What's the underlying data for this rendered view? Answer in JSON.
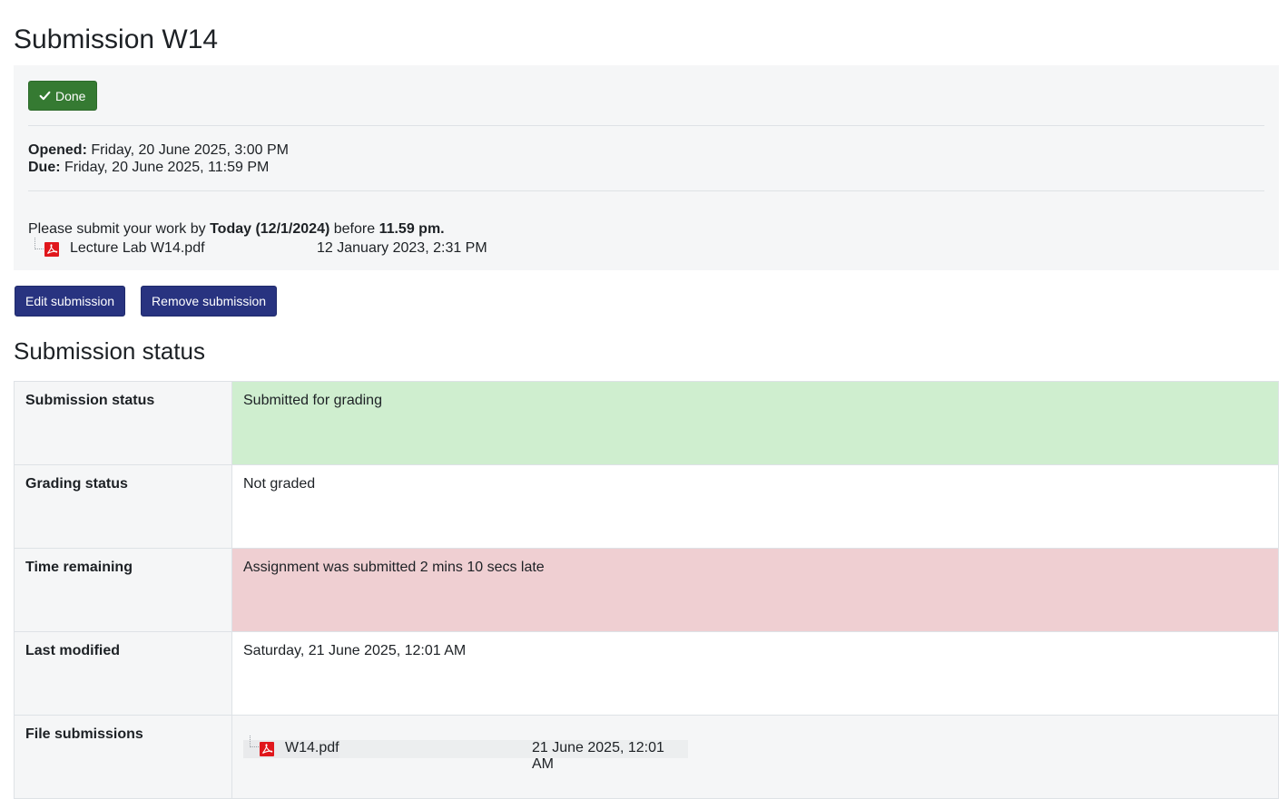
{
  "page_title": "Submission W14",
  "completion": {
    "done_label": "Done"
  },
  "dates": {
    "opened_label": "Opened:",
    "opened_value": "Friday, 20 June 2025, 3:00 PM",
    "due_label": "Due:",
    "due_value": "Friday, 20 June 2025, 11:59 PM"
  },
  "intro": {
    "prefix": "Please submit your work by ",
    "deadline_bold": "Today (12/1/2024)",
    "middle": " before ",
    "time_bold": "11.59 pm."
  },
  "attachment": {
    "icon": "pdf-icon",
    "name": "Lecture Lab W14.pdf",
    "date": "12 January 2023, 2:31 PM"
  },
  "actions": {
    "edit_label": "Edit submission",
    "remove_label": "Remove submission"
  },
  "section_title": "Submission status",
  "status_rows": [
    {
      "label": "Submission status",
      "value": "Submitted for grading",
      "color": "#cfeecf"
    },
    {
      "label": "Grading status",
      "value": "Not graded",
      "color": "#ffffff"
    },
    {
      "label": "Time remaining",
      "value": "Assignment was submitted 2 mins 10 secs late",
      "color": "#efcfd2"
    },
    {
      "label": "Last modified",
      "value": "Saturday, 21 June 2025, 12:01 AM",
      "color": "#ffffff"
    },
    {
      "label": "File submissions",
      "file_name": "W14.pdf",
      "file_date": "21 June 2025, 12:01 AM",
      "color": "#f5f6f7"
    }
  ],
  "colors": {
    "done_button": "#357a32",
    "primary_button": "#283380",
    "submitted_bg": "#cfeecf",
    "late_bg": "#efcfd2"
  }
}
